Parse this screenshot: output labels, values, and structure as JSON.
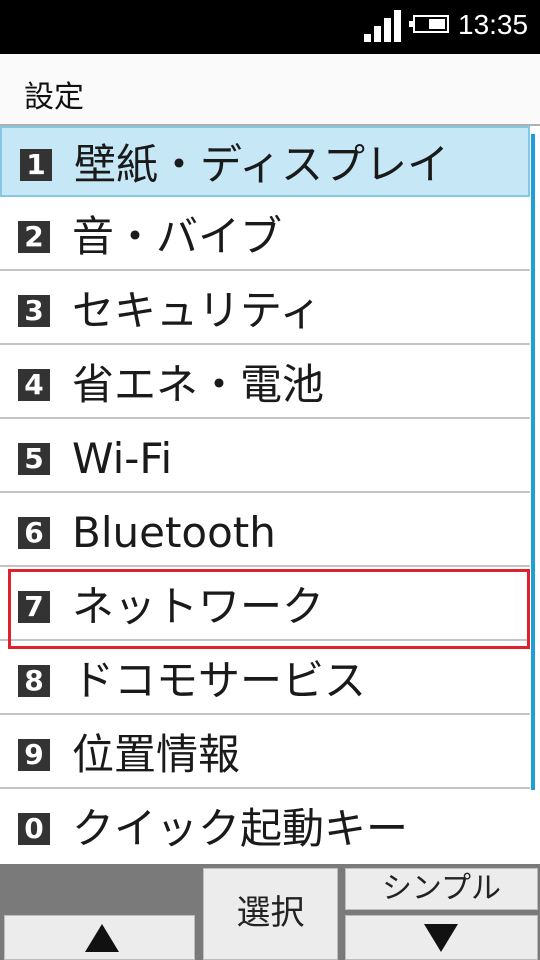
{
  "status_bar": {
    "time": "13:35",
    "signal_icon": "signal-strength-icon",
    "battery_icon": "battery-icon"
  },
  "header": {
    "title": "設定"
  },
  "menu": {
    "items": [
      {
        "number": "1",
        "label": "壁紙・ディスプレイ",
        "selected": true
      },
      {
        "number": "2",
        "label": "音・バイブ"
      },
      {
        "number": "3",
        "label": "セキュリティ"
      },
      {
        "number": "4",
        "label": "省エネ・電池"
      },
      {
        "number": "5",
        "label": "Wi-Fi"
      },
      {
        "number": "6",
        "label": "Bluetooth"
      },
      {
        "number": "7",
        "label": "ネットワーク",
        "highlighted": true
      },
      {
        "number": "8",
        "label": "ドコモサービス"
      },
      {
        "number": "9",
        "label": "位置情報"
      },
      {
        "number": "0",
        "label": "クイック起動キー"
      }
    ]
  },
  "softkeys": {
    "up_icon": "up-arrow-icon",
    "select_label": "選択",
    "simple_label": "シンプル",
    "down_icon": "down-arrow-icon"
  },
  "colors": {
    "selected_background": "#c6e8f6",
    "highlight_border": "#e0202a",
    "scrollbar": "#1e9fd8",
    "status_bar": "#000000",
    "softkey_bar": "#7a7a7a"
  }
}
